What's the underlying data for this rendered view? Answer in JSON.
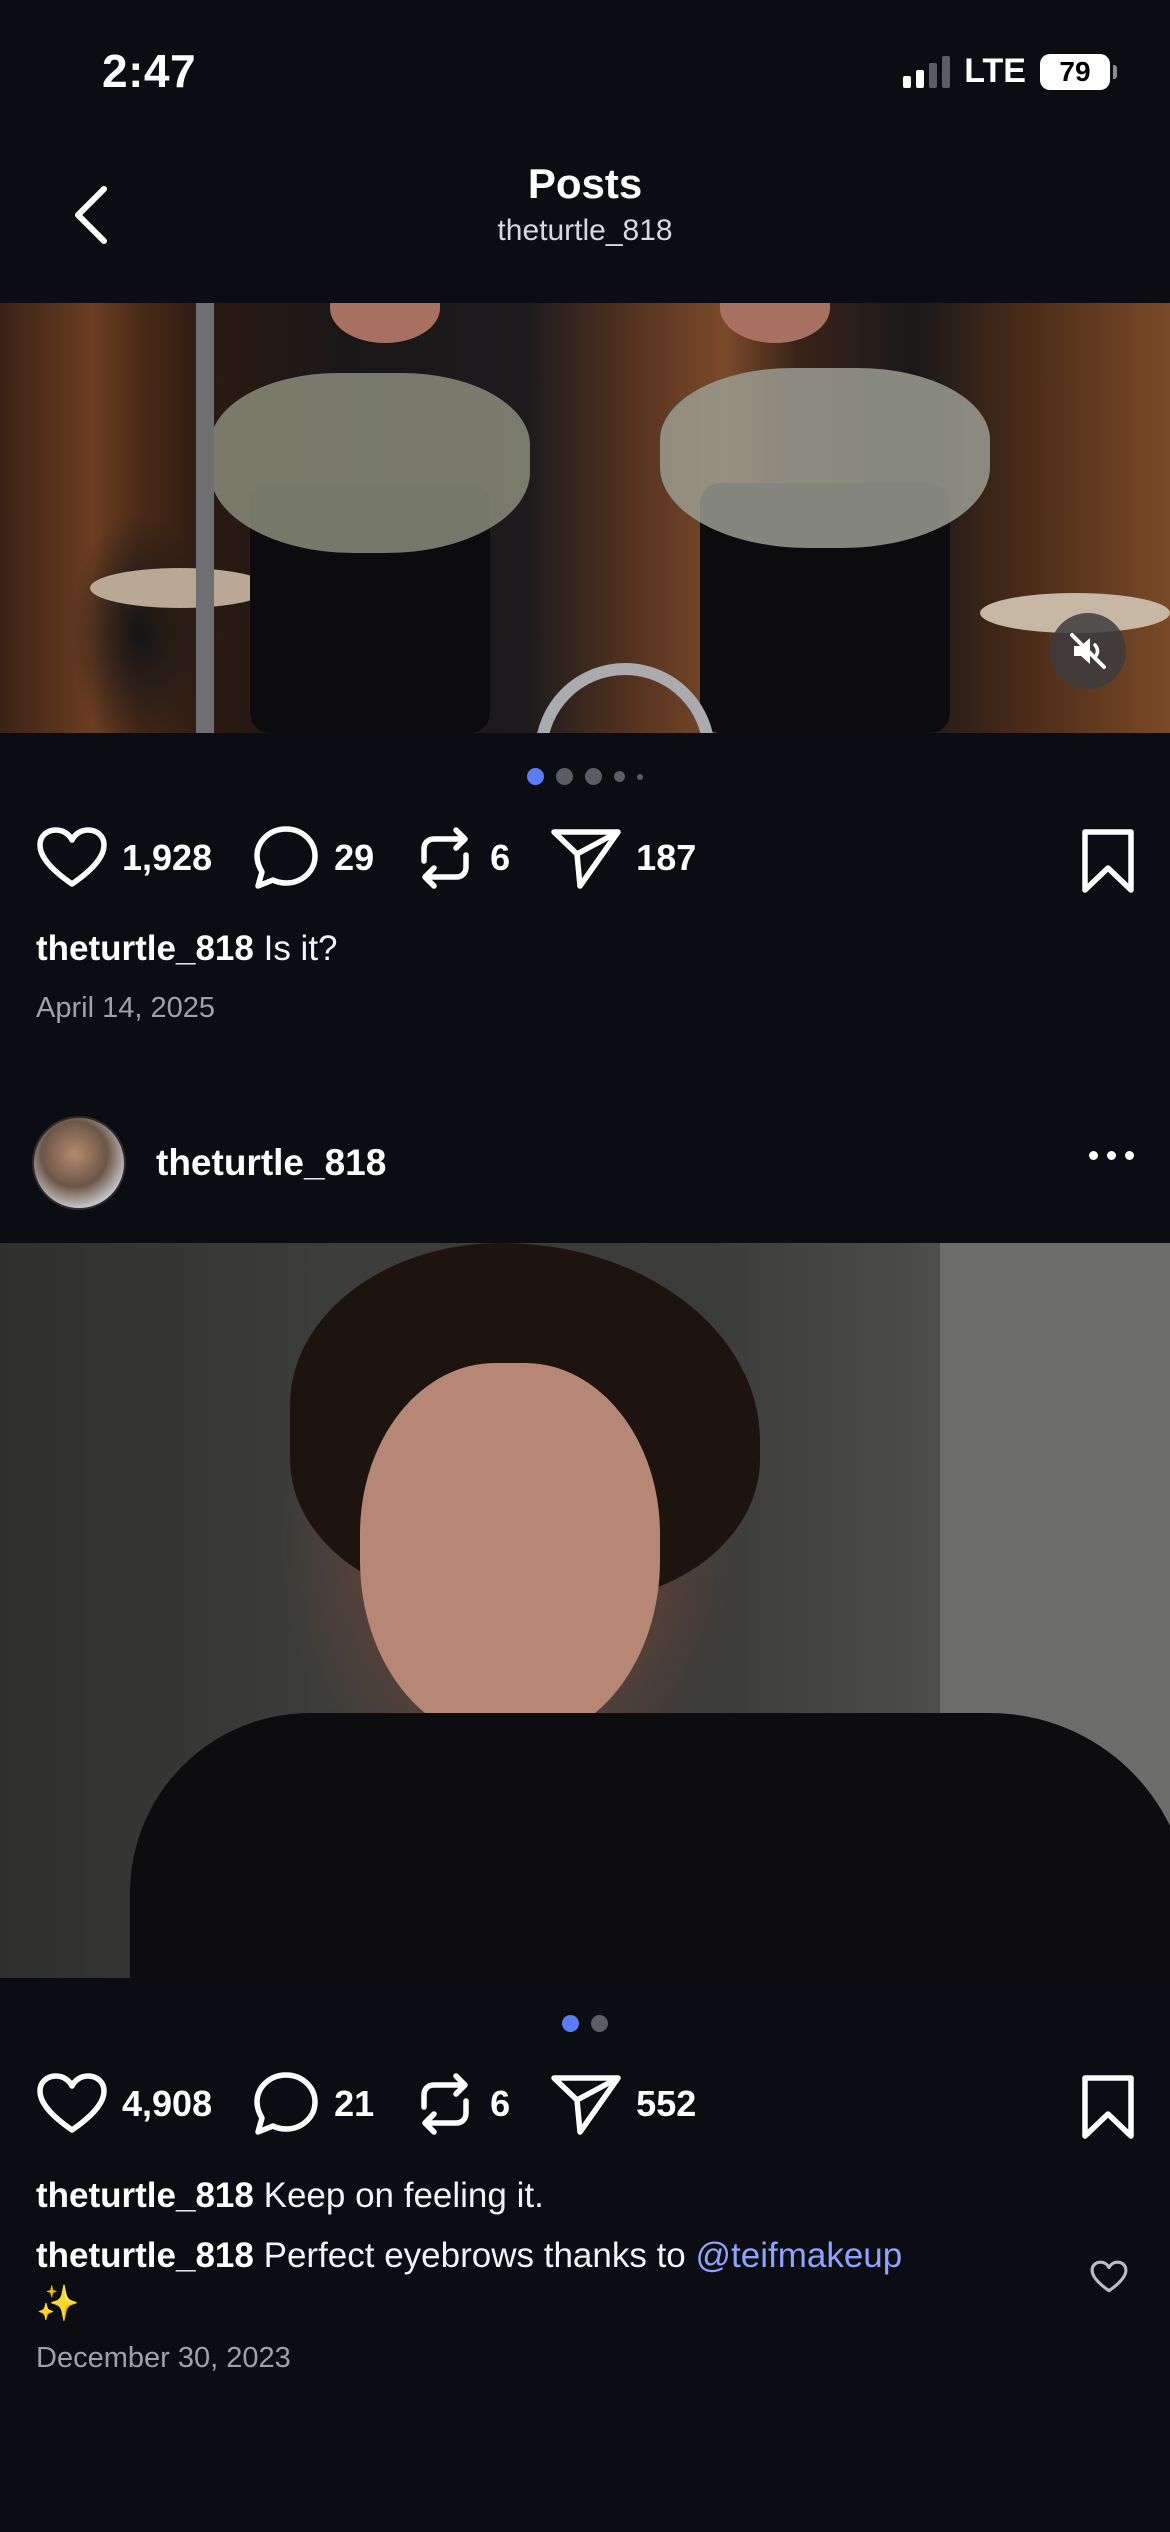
{
  "status_bar": {
    "time": "2:47",
    "network": "LTE",
    "battery": "79"
  },
  "header": {
    "title": "Posts",
    "subtitle": "theturtle_818"
  },
  "post1": {
    "media_dots": 5,
    "likes": "1,928",
    "comments": "29",
    "reposts": "6",
    "shares": "187",
    "caption_user": "theturtle_818",
    "caption_text": "Is it?",
    "date": "April 14, 2025"
  },
  "post2": {
    "username": "theturtle_818",
    "media_dots": 2,
    "likes": "4,908",
    "comments": "21",
    "reposts": "6",
    "shares": "552",
    "caption_user": "theturtle_818",
    "caption_text": "Keep on feeling it.",
    "comment_user": "theturtle_818",
    "comment_text": "Perfect eyebrows thanks to",
    "comment_mention": "@teifmakeup",
    "comment_emoji": "✨",
    "date": "December 30, 2023"
  },
  "colors": {
    "background": "#0b0d12",
    "accent": "#5b7cf5",
    "mention": "#8ea2ff"
  }
}
